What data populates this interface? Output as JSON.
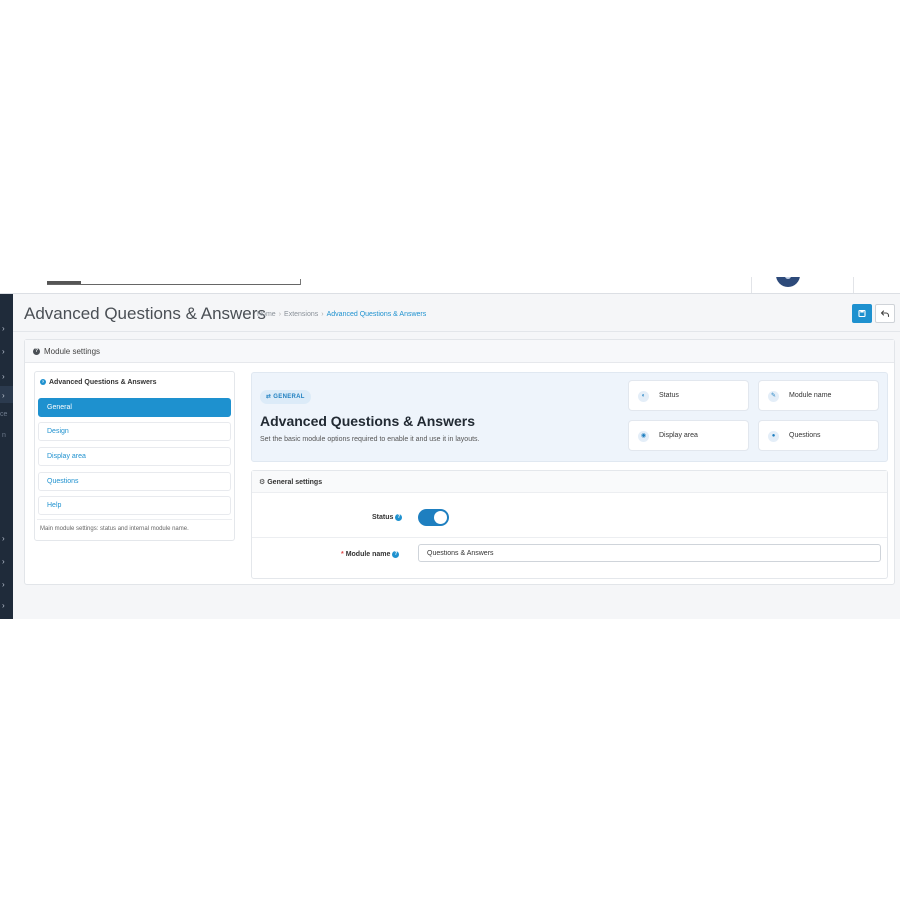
{
  "header": {
    "title": "Advanced Questions & Answers",
    "breadcrumb": [
      "Home",
      "Extensions",
      "Advanced Questions & Answers"
    ]
  },
  "toolbar": {
    "save_icon": "save-icon",
    "back_icon": "back-arrow-icon"
  },
  "sidebar": {
    "partial_labels": [
      "ce",
      "n"
    ]
  },
  "card": {
    "title": "Module settings"
  },
  "nav": {
    "heading": "Advanced Questions & Answers",
    "items": [
      {
        "label": "General",
        "active": true
      },
      {
        "label": "Design"
      },
      {
        "label": "Display area"
      },
      {
        "label": "Questions"
      },
      {
        "label": "Help"
      }
    ],
    "help_text": "Main module settings: status and internal module name."
  },
  "hero": {
    "badge": "GENERAL",
    "title": "Advanced Questions & Answers",
    "description": "Set the basic module options required to enable it and use it in layouts.",
    "features": [
      {
        "label": "Status",
        "icon": "toggle-icon"
      },
      {
        "label": "Module name",
        "icon": "pencil-icon"
      },
      {
        "label": "Display area",
        "icon": "eye-icon"
      },
      {
        "label": "Questions",
        "icon": "comments-icon"
      }
    ]
  },
  "general_settings": {
    "title": "General settings",
    "status_label": "Status",
    "status_enabled": true,
    "module_name_required": "*",
    "module_name_label": "Module name",
    "module_name_value": "Questions & Answers"
  },
  "colors": {
    "accent": "#1e91cf",
    "sidebar": "#1f2b3a"
  }
}
